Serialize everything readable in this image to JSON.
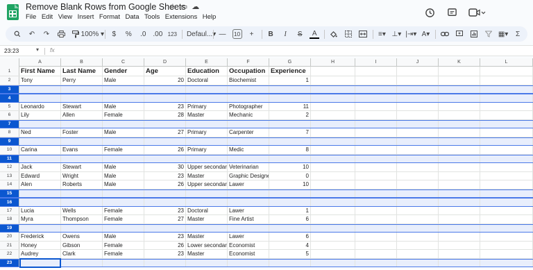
{
  "title_bar": {
    "doc_title": "Remove Blank Rows from Google Sheets",
    "menu": [
      "File",
      "Edit",
      "View",
      "Insert",
      "Format",
      "Data",
      "Tools",
      "Extensions",
      "Help"
    ]
  },
  "toolbar": {
    "zoom": "100%",
    "currency": "$",
    "percent": "%",
    "decrease_decimal": ".0",
    "increase_decimal": ".00",
    "number_format": "123",
    "font": "Defaul...",
    "font_size": "10"
  },
  "formula_bar": {
    "name_box": "23:23",
    "fx_label": "fx"
  },
  "columns": [
    "A",
    "B",
    "C",
    "D",
    "E",
    "F",
    "G",
    "H",
    "I",
    "J",
    "K",
    "L"
  ],
  "headers": [
    "First Name",
    "Last Name",
    "Gender",
    "Age",
    "Education",
    "Occupation",
    "Experience"
  ],
  "rows": [
    {
      "num": "2",
      "blank": false,
      "cells": [
        "Tony",
        "Perry",
        "Male",
        "20",
        "Doctoral",
        "Biochemist",
        "1"
      ]
    },
    {
      "num": "3",
      "blank": true,
      "cells": []
    },
    {
      "num": "4",
      "blank": true,
      "cells": []
    },
    {
      "num": "5",
      "blank": false,
      "cells": [
        "Leonardo",
        "Stewart",
        "Male",
        "23",
        "Primary",
        "Photographer",
        "11"
      ]
    },
    {
      "num": "6",
      "blank": false,
      "cells": [
        "Lily",
        "Allen",
        "Female",
        "28",
        "Master",
        "Mechanic",
        "2"
      ]
    },
    {
      "num": "7",
      "blank": true,
      "cells": []
    },
    {
      "num": "8",
      "blank": false,
      "cells": [
        "Ned",
        "Foster",
        "Male",
        "27",
        "Primary",
        "Carpenter",
        "7"
      ]
    },
    {
      "num": "9",
      "blank": true,
      "cells": []
    },
    {
      "num": "10",
      "blank": false,
      "cells": [
        "Carina",
        "Evans",
        "Female",
        "26",
        "Primary",
        "Medic",
        "8"
      ]
    },
    {
      "num": "11",
      "blank": true,
      "cells": []
    },
    {
      "num": "12",
      "blank": false,
      "cells": [
        "Jack",
        "Stewart",
        "Male",
        "30",
        "Upper secondar",
        "Veterinarian",
        "10"
      ]
    },
    {
      "num": "13",
      "blank": false,
      "cells": [
        "Edward",
        "Wright",
        "Male",
        "23",
        "Master",
        "Graphic Designe",
        "0"
      ]
    },
    {
      "num": "14",
      "blank": false,
      "cells": [
        "Alen",
        "Roberts",
        "Male",
        "26",
        "Upper secondar",
        "Lawer",
        "10"
      ]
    },
    {
      "num": "15",
      "blank": true,
      "cells": []
    },
    {
      "num": "16",
      "blank": true,
      "cells": []
    },
    {
      "num": "17",
      "blank": false,
      "cells": [
        "Lucia",
        "Wells",
        "Female",
        "23",
        "Doctoral",
        "Lawer",
        "1"
      ]
    },
    {
      "num": "18",
      "blank": false,
      "cells": [
        "Myra",
        "Thompson",
        "Female",
        "27",
        "Master",
        "Fine Artist",
        "6"
      ]
    },
    {
      "num": "19",
      "blank": true,
      "cells": []
    },
    {
      "num": "20",
      "blank": false,
      "cells": [
        "Frederick",
        "Owens",
        "Male",
        "23",
        "Master",
        "Lawer",
        "6"
      ]
    },
    {
      "num": "21",
      "blank": false,
      "cells": [
        "Honey",
        "Gibson",
        "Female",
        "26",
        "Lower secondar",
        "Economist",
        "4"
      ]
    },
    {
      "num": "22",
      "blank": false,
      "cells": [
        "Audrey",
        "Clark",
        "Female",
        "23",
        "Master",
        "Economist",
        "5"
      ]
    },
    {
      "num": "23",
      "blank": true,
      "cells": []
    }
  ],
  "selected_rows": [
    "3",
    "4",
    "7",
    "9",
    "11",
    "15",
    "16",
    "19",
    "23"
  ],
  "colors": {
    "accent": "#0b57d0",
    "selection_fill": "#e8eefc",
    "sheets_green": "#1ea362"
  }
}
